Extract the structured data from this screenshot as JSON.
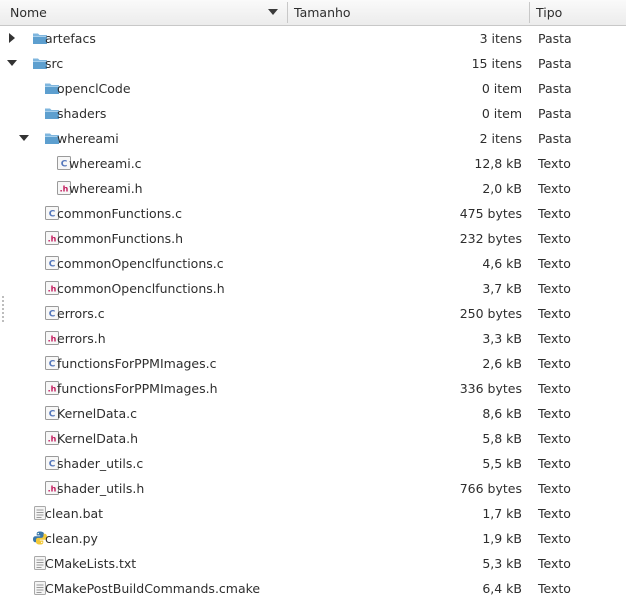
{
  "header": {
    "name_label": "Nome",
    "size_label": "Tamanho",
    "type_label": "Tipo"
  },
  "colors": {
    "folder": "#5d9fcf",
    "c_file_accent": "#5577bb",
    "h_file_accent": "#c2185b"
  },
  "rows": [
    {
      "name": "artefacs",
      "size": "3 itens",
      "type": "Pasta",
      "icon": "folder",
      "level": 0,
      "expander": "closed"
    },
    {
      "name": "src",
      "size": "15 itens",
      "type": "Pasta",
      "icon": "folder",
      "level": 0,
      "expander": "open"
    },
    {
      "name": "openclCode",
      "size": "0 item",
      "type": "Pasta",
      "icon": "folder",
      "level": 1,
      "expander": "none"
    },
    {
      "name": "shaders",
      "size": "0 item",
      "type": "Pasta",
      "icon": "folder",
      "level": 1,
      "expander": "none"
    },
    {
      "name": "whereami",
      "size": "2 itens",
      "type": "Pasta",
      "icon": "folder",
      "level": 1,
      "expander": "open"
    },
    {
      "name": "whereami.c",
      "size": "12,8 kB",
      "type": "Texto",
      "icon": "c-file",
      "level": 2,
      "expander": "none"
    },
    {
      "name": "whereami.h",
      "size": "2,0 kB",
      "type": "Texto",
      "icon": "h-file",
      "level": 2,
      "expander": "none"
    },
    {
      "name": "commonFunctions.c",
      "size": "475 bytes",
      "type": "Texto",
      "icon": "c-file",
      "level": 1,
      "expander": "none"
    },
    {
      "name": "commonFunctions.h",
      "size": "232 bytes",
      "type": "Texto",
      "icon": "h-file",
      "level": 1,
      "expander": "none"
    },
    {
      "name": "commonOpenclfunctions.c",
      "size": "4,6 kB",
      "type": "Texto",
      "icon": "c-file",
      "level": 1,
      "expander": "none"
    },
    {
      "name": "commonOpenclfunctions.h",
      "size": "3,7 kB",
      "type": "Texto",
      "icon": "h-file",
      "level": 1,
      "expander": "none"
    },
    {
      "name": "errors.c",
      "size": "250 bytes",
      "type": "Texto",
      "icon": "c-file",
      "level": 1,
      "expander": "none"
    },
    {
      "name": "errors.h",
      "size": "3,3 kB",
      "type": "Texto",
      "icon": "h-file",
      "level": 1,
      "expander": "none"
    },
    {
      "name": "functionsForPPMImages.c",
      "size": "2,6 kB",
      "type": "Texto",
      "icon": "c-file",
      "level": 1,
      "expander": "none"
    },
    {
      "name": "functionsForPPMImages.h",
      "size": "336 bytes",
      "type": "Texto",
      "icon": "h-file",
      "level": 1,
      "expander": "none"
    },
    {
      "name": "KernelData.c",
      "size": "8,6 kB",
      "type": "Texto",
      "icon": "c-file",
      "level": 1,
      "expander": "none"
    },
    {
      "name": "KernelData.h",
      "size": "5,8 kB",
      "type": "Texto",
      "icon": "h-file",
      "level": 1,
      "expander": "none"
    },
    {
      "name": "shader_utils.c",
      "size": "5,5 kB",
      "type": "Texto",
      "icon": "c-file",
      "level": 1,
      "expander": "none"
    },
    {
      "name": "shader_utils.h",
      "size": "766 bytes",
      "type": "Texto",
      "icon": "h-file",
      "level": 1,
      "expander": "none"
    },
    {
      "name": "clean.bat",
      "size": "1,7 kB",
      "type": "Texto",
      "icon": "text-file",
      "level": 0,
      "expander": "none"
    },
    {
      "name": "clean.py",
      "size": "1,9 kB",
      "type": "Texto",
      "icon": "python-file",
      "level": 0,
      "expander": "none"
    },
    {
      "name": "CMakeLists.txt",
      "size": "5,3 kB",
      "type": "Texto",
      "icon": "text-file",
      "level": 0,
      "expander": "none"
    },
    {
      "name": "CMakePostBuildCommands.cmake",
      "size": "6,4 kB",
      "type": "Texto",
      "icon": "text-file",
      "level": 0,
      "expander": "none"
    }
  ]
}
